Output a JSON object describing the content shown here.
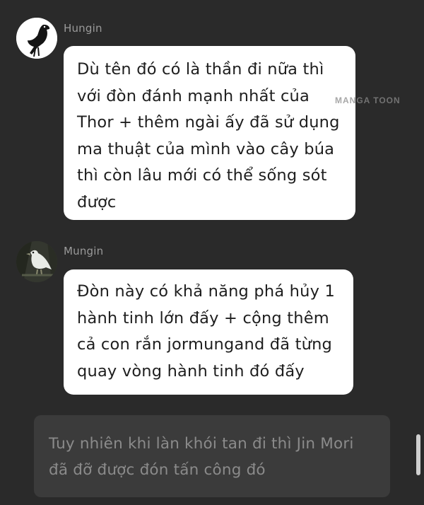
{
  "watermark": "MANGA TOON",
  "messages": [
    {
      "sender": "Hungin",
      "avatar": "crow-avatar",
      "text": "Dù tên đó có là thần đi nữa thì\nvới đòn đánh mạnh nhất của\nThor + thêm ngài ấy đã sử dụng\nma thuật của mình vào cây búa\nthì còn lâu mới có thể sống sót\nđược"
    },
    {
      "sender": "Mungin",
      "avatar": "white-bird-avatar",
      "text": "Đòn này có khả năng phá hủy 1\nhành tinh lớn đấy + cộng thêm\ncả con rắn jormungand đã từng\nquay vòng hành tinh đó đấy"
    }
  ],
  "narration": {
    "text": "Tuy nhiên khi làn khói tan đi thì Jin Mori\nđã đỡ được đón tấn công đó"
  },
  "colors": {
    "background": "#2a2a2a",
    "bubble": "#ffffff",
    "narration_bg": "#3b3b3b",
    "sender_text": "#9a9a9a"
  }
}
